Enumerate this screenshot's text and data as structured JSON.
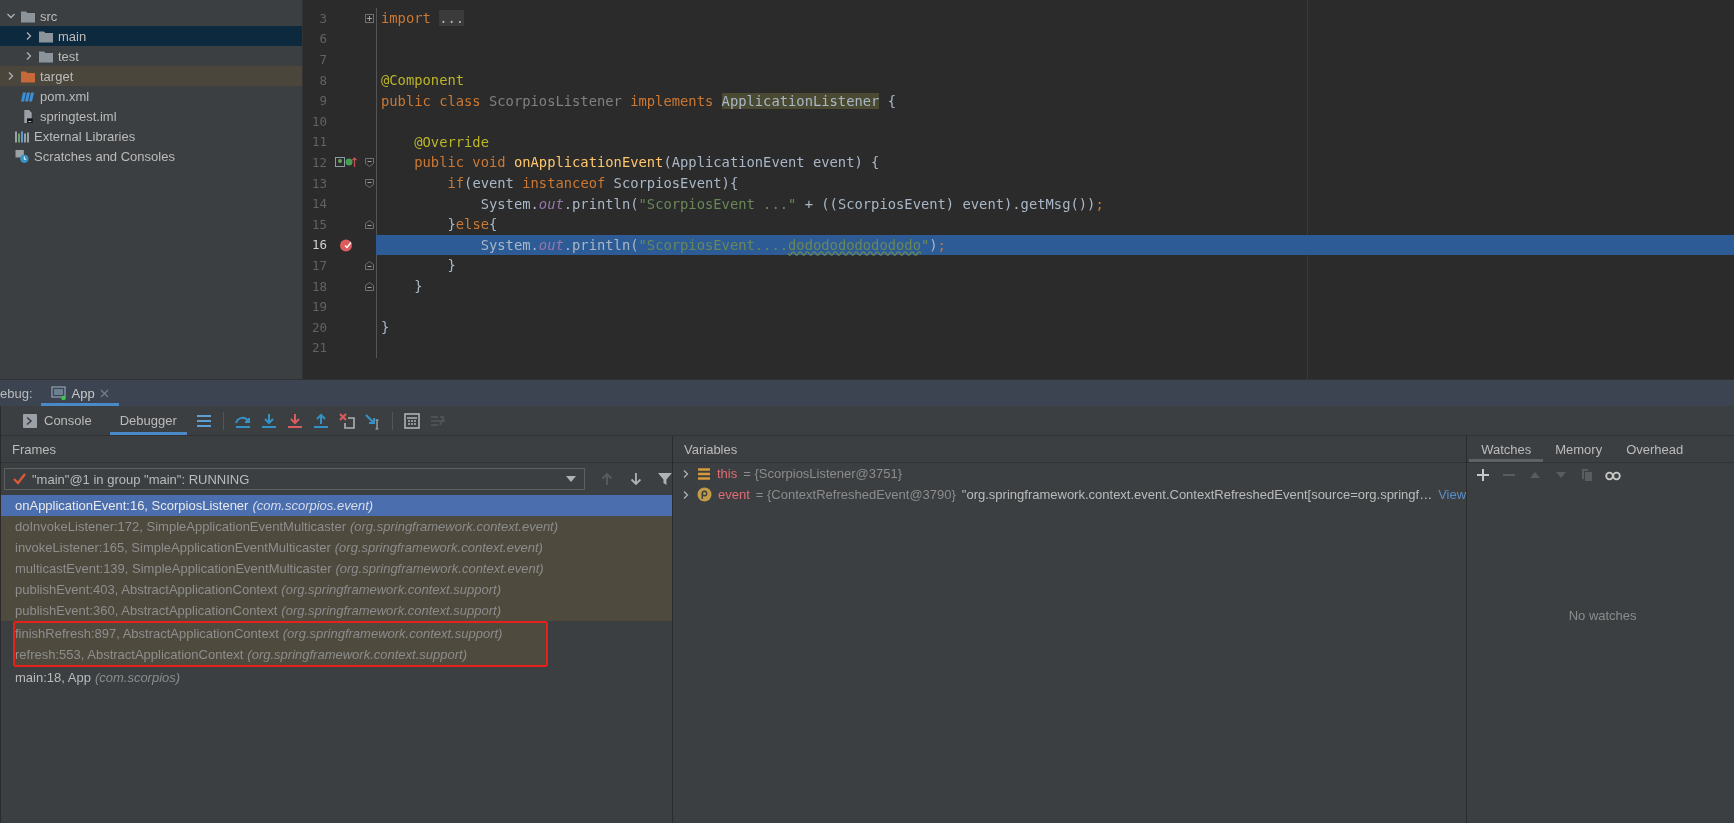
{
  "project_tree": {
    "module_items": [
      {
        "label": "src",
        "kind": "folder",
        "selected": false,
        "expanded": true,
        "children": [
          {
            "label": "main",
            "kind": "folder",
            "selected": true,
            "expanded": false
          },
          {
            "label": "test",
            "kind": "folder",
            "selected": false,
            "expanded": false
          }
        ]
      },
      {
        "label": "target",
        "kind": "excluded-folder",
        "selected": false,
        "expanded": false
      },
      {
        "label": "pom.xml",
        "kind": "maven",
        "selected": false
      },
      {
        "label": "springtest.iml",
        "kind": "module-file",
        "selected": false
      }
    ],
    "root_items": [
      {
        "label": "External Libraries",
        "kind": "libraries",
        "selected": false
      },
      {
        "label": "Scratches and Consoles",
        "kind": "scratches",
        "selected": false
      }
    ]
  },
  "editor": {
    "lines": [
      {
        "number": "3",
        "current": false,
        "fold": {
          "kind": "expand"
        },
        "tokens": [
          {
            "text": "import ",
            "kind": "keyword"
          },
          {
            "text": "...",
            "kind": "folded"
          }
        ]
      },
      {
        "number": "6",
        "current": false
      },
      {
        "number": "7",
        "current": false
      },
      {
        "number": "8",
        "current": false,
        "tokens": [
          {
            "text": "@Component",
            "kind": "annotation"
          }
        ]
      },
      {
        "number": "9",
        "current": false,
        "tokens": [
          {
            "text": "public class ",
            "kind": "keyword"
          },
          {
            "text": "ScorpiosListener",
            "kind": "unused"
          },
          {
            "text": " implements ",
            "kind": "keyword"
          },
          {
            "text": "ApplicationListener",
            "kind": "usage"
          },
          {
            "text": " {",
            "kind": "plain"
          }
        ]
      },
      {
        "number": "10",
        "current": false
      },
      {
        "number": "11",
        "current": false,
        "tokens": [
          {
            "text": "    @Override",
            "kind": "annotation"
          }
        ]
      },
      {
        "number": "12",
        "current": false,
        "marker": {
          "kind": "override"
        },
        "fold": {
          "kind": "start"
        },
        "tokens": [
          {
            "text": "    public void ",
            "kind": "keyword"
          },
          {
            "text": "onApplicationEvent",
            "kind": "method"
          },
          {
            "text": "(ApplicationEvent event) {",
            "kind": "plain"
          }
        ]
      },
      {
        "number": "13",
        "current": false,
        "fold": {
          "kind": "start"
        },
        "tokens": [
          {
            "text": "        if",
            "kind": "keyword"
          },
          {
            "text": "(event ",
            "kind": "plain"
          },
          {
            "text": "instanceof",
            "kind": "keyword"
          },
          {
            "text": " ScorpiosEvent){",
            "kind": "plain"
          }
        ]
      },
      {
        "number": "14",
        "current": false,
        "tokens": [
          {
            "text": "            System.",
            "kind": "plain"
          },
          {
            "text": "out",
            "kind": "field"
          },
          {
            "text": ".println(",
            "kind": "plain"
          },
          {
            "text": "\"ScorpiosEvent ...\"",
            "kind": "string"
          },
          {
            "text": " + ((ScorpiosEvent) event).getMsg())",
            "kind": "plain"
          },
          {
            "text": ";",
            "kind": "keyword"
          }
        ]
      },
      {
        "number": "15",
        "current": false,
        "fold": {
          "kind": "end"
        },
        "tokens": [
          {
            "text": "        }",
            "kind": "plain"
          },
          {
            "text": "else",
            "kind": "keyword"
          },
          {
            "text": "{",
            "kind": "plain"
          }
        ]
      },
      {
        "number": "16",
        "current": true,
        "marker": {
          "kind": "breakpoint"
        },
        "tokens": [
          {
            "text": "            System.",
            "kind": "plain"
          },
          {
            "text": "out",
            "kind": "field"
          },
          {
            "text": ".println(",
            "kind": "plain"
          },
          {
            "text": "\"ScorpiosEvent....",
            "kind": "string"
          },
          {
            "text": "dodododododododo",
            "kind": "typo"
          },
          {
            "text": "\"",
            "kind": "string"
          },
          {
            "text": ")",
            "kind": "plain"
          },
          {
            "text": ";",
            "kind": "keyword"
          }
        ]
      },
      {
        "number": "17",
        "current": false,
        "fold": {
          "kind": "end"
        },
        "tokens": [
          {
            "text": "        }",
            "kind": "plain"
          }
        ]
      },
      {
        "number": "18",
        "current": false,
        "fold": {
          "kind": "end"
        },
        "tokens": [
          {
            "text": "    }",
            "kind": "plain"
          }
        ]
      },
      {
        "number": "19",
        "current": false
      },
      {
        "number": "20",
        "current": false,
        "tokens": [
          {
            "text": "}",
            "kind": "plain"
          }
        ]
      },
      {
        "number": "21",
        "current": false
      }
    ]
  },
  "debug": {
    "label": "ebug:",
    "session_tab": {
      "label": "App",
      "selected": true
    },
    "tabs": [
      {
        "label": "Console",
        "kind": "console",
        "selected": false
      },
      {
        "label": "Debugger",
        "kind": "debugger",
        "selected": true
      }
    ],
    "toolbar": [
      {
        "kind": "layout",
        "disabled": false
      },
      {
        "kind": "sep"
      },
      {
        "kind": "step-over",
        "disabled": false
      },
      {
        "kind": "step-into",
        "disabled": false
      },
      {
        "kind": "force-step-into",
        "disabled": false
      },
      {
        "kind": "step-out",
        "disabled": false
      },
      {
        "kind": "drop-frame",
        "disabled": false
      },
      {
        "kind": "run-to-cursor",
        "disabled": false
      },
      {
        "kind": "sep"
      },
      {
        "kind": "evaluate",
        "disabled": false
      },
      {
        "kind": "trace",
        "disabled": true
      }
    ],
    "frames": {
      "title": "Frames",
      "thread": "\"main\"@1 in group \"main\": RUNNING",
      "nav": [
        {
          "kind": "up",
          "disabled": true
        },
        {
          "kind": "down",
          "disabled": false
        },
        {
          "kind": "filter",
          "disabled": false
        }
      ],
      "items": [
        {
          "method": "onApplicationEvent:16, ScorpiosListener",
          "package": "(com.scorpios.event)",
          "selected": true,
          "library": false,
          "marked": false
        },
        {
          "method": "doInvokeListener:172, SimpleApplicationEventMulticaster",
          "package": "(org.springframework.context.event)",
          "selected": false,
          "library": true,
          "marked": false
        },
        {
          "method": "invokeListener:165, SimpleApplicationEventMulticaster",
          "package": "(org.springframework.context.event)",
          "selected": false,
          "library": true,
          "marked": false
        },
        {
          "method": "multicastEvent:139, SimpleApplicationEventMulticaster",
          "package": "(org.springframework.context.event)",
          "selected": false,
          "library": true,
          "marked": false
        },
        {
          "method": "publishEvent:403, AbstractApplicationContext",
          "package": "(org.springframework.context.support)",
          "selected": false,
          "library": true,
          "marked": false
        },
        {
          "method": "publishEvent:360, AbstractApplicationContext",
          "package": "(org.springframework.context.support)",
          "selected": false,
          "library": true,
          "marked": false
        },
        {
          "method": "finishRefresh:897, AbstractApplicationContext",
          "package": "(org.springframework.context.support)",
          "selected": false,
          "library": true,
          "marked": true
        },
        {
          "method": "refresh:553, AbstractApplicationContext",
          "package": "(org.springframework.context.support)",
          "selected": false,
          "library": true,
          "marked": true
        },
        {
          "method": "main:18, App",
          "package": "(com.scorpios)",
          "selected": false,
          "library": false,
          "marked": false
        }
      ]
    },
    "variables": {
      "title": "Variables",
      "items": [
        {
          "kind": "object",
          "name": "this",
          "value": "= {ScorpiosListener@3751}",
          "expanded": false
        },
        {
          "kind": "parameter",
          "name": "event",
          "value": "= {ContextRefreshedEvent@3790}",
          "detail": "\"org.springframework.context.event.ContextRefreshedEvent[source=org.springf…",
          "link": "View",
          "expanded": false
        }
      ]
    },
    "watches": {
      "tabs": [
        {
          "label": "Watches",
          "selected": true
        },
        {
          "label": "Memory",
          "selected": false
        },
        {
          "label": "Overhead",
          "selected": false
        }
      ],
      "toolbar": [
        {
          "kind": "add",
          "disabled": false
        },
        {
          "kind": "remove",
          "disabled": true
        },
        {
          "kind": "move-up",
          "disabled": true
        },
        {
          "kind": "move-down",
          "disabled": true
        },
        {
          "kind": "copy",
          "disabled": true
        },
        {
          "kind": "glasses",
          "disabled": false
        }
      ],
      "empty_text": "No watches"
    }
  }
}
